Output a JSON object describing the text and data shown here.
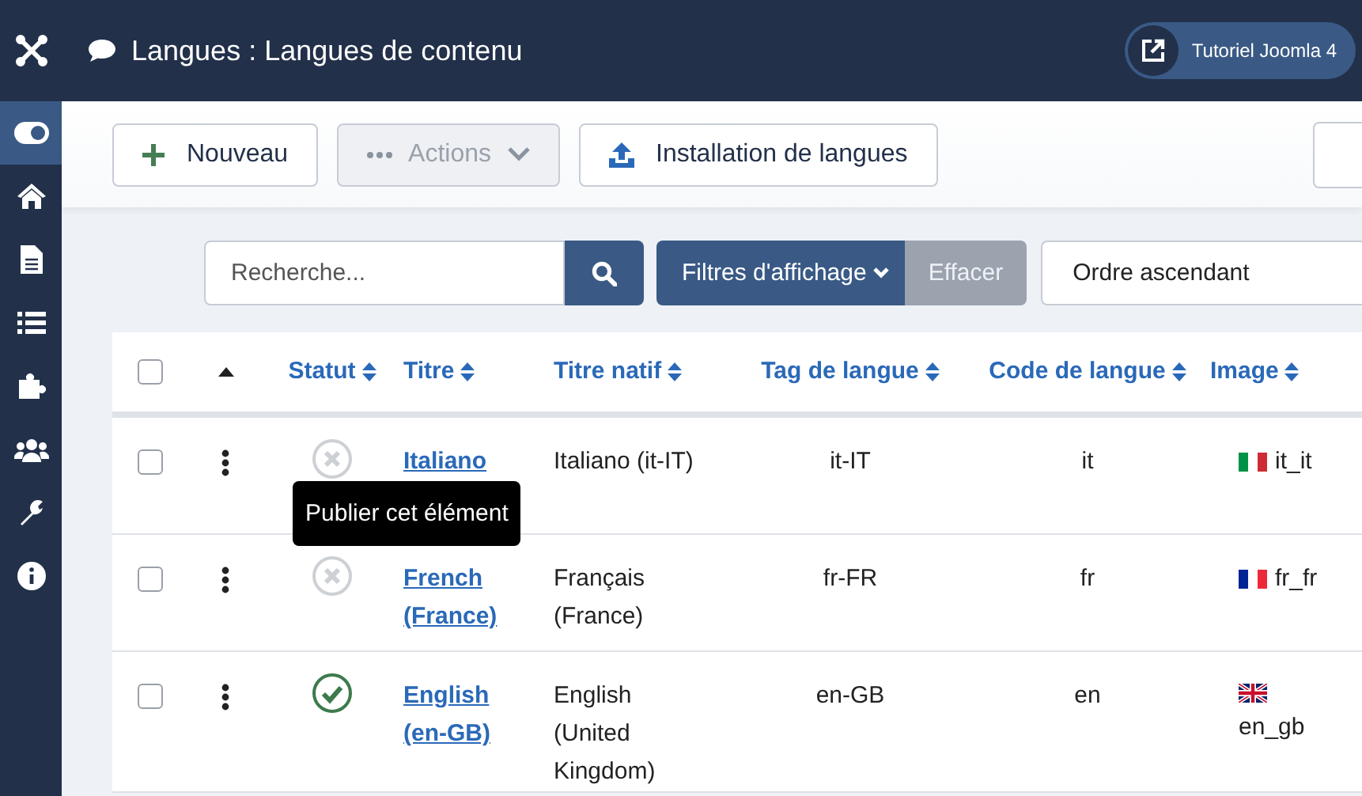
{
  "sidebar": {
    "items": [
      {
        "selected": false
      },
      {
        "selected": true
      },
      {
        "selected": false
      },
      {
        "selected": false
      },
      {
        "selected": false
      },
      {
        "selected": false
      },
      {
        "selected": false
      },
      {
        "selected": false
      },
      {
        "selected": false
      }
    ]
  },
  "header": {
    "title": "Langues : Langues de contenu",
    "site_link": "Tutoriel Joomla 4"
  },
  "toolbar": {
    "buttons": [
      {
        "kind": "new",
        "label": "Nouveau",
        "disabled": false
      },
      {
        "kind": "actions",
        "label": "Actions",
        "disabled": true
      },
      {
        "kind": "install",
        "label": "Installation de langues",
        "disabled": false
      }
    ]
  },
  "filters": {
    "search": {
      "placeholder": "Recherche..."
    },
    "filter_button": "Filtres d'affichage",
    "clear_button": "Effacer",
    "ordering": "Ordre ascendant"
  },
  "table": {
    "select_all": {
      "checked": false
    },
    "columns": [
      {
        "label": "Statut"
      },
      {
        "label": "Titre"
      },
      {
        "label": "Titre natif"
      },
      {
        "label": "Tag de langue"
      },
      {
        "label": "Code de langue"
      },
      {
        "label": "Image"
      }
    ],
    "rows": [
      {
        "checked": false,
        "published": false,
        "title": "Italiano",
        "native_title": "Italiano (it-IT)",
        "tag": "it-IT",
        "code": "it",
        "image": {
          "kind": "it",
          "label": "it_it"
        }
      },
      {
        "checked": false,
        "published": false,
        "title": "French (France)",
        "native_title": "Français (France)",
        "tag": "fr-FR",
        "code": "fr",
        "image": {
          "kind": "fr",
          "label": "fr_fr"
        }
      },
      {
        "checked": false,
        "published": true,
        "title": "English (en-GB)",
        "native_title": "English (United Kingdom)",
        "tag": "en-GB",
        "code": "en",
        "image": {
          "kind": "gb",
          "label": "en_gb"
        }
      }
    ]
  },
  "tooltip": {
    "text": "Publier cet élément"
  }
}
